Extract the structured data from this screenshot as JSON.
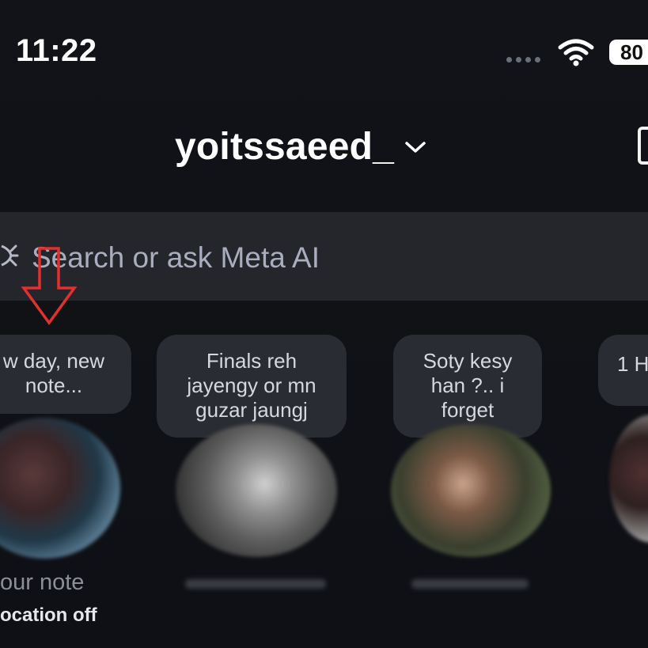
{
  "status_bar": {
    "time": "11:22",
    "battery": "80",
    "wifi_icon": "wifi-icon",
    "signal_icon": "cellular-dots-icon"
  },
  "header": {
    "username": "yoitssaeed_",
    "chevron_icon": "chevron-down-icon",
    "compose_icon": "compose-icon"
  },
  "search": {
    "icon": "meta-ai-icon",
    "placeholder": "Search or ask Meta AI"
  },
  "notes": [
    {
      "bubble": "w day, new\nnote...",
      "label": "our note",
      "sublabel": "ocation off"
    },
    {
      "bubble": "Finals reh\njayengy or mn\nguzar jaungj",
      "label": ""
    },
    {
      "bubble": "Soty kesy\nhan ?.. i\nforget",
      "label": ""
    },
    {
      "bubble": "1 H",
      "label": ""
    }
  ],
  "annotation": {
    "icon": "red-down-arrow",
    "color": "#e0312f"
  },
  "colors": {
    "background": "#0f1116",
    "search_bg": "#24262c",
    "bubble_bg": "#2a2c33",
    "arrow": "#e0312f"
  }
}
